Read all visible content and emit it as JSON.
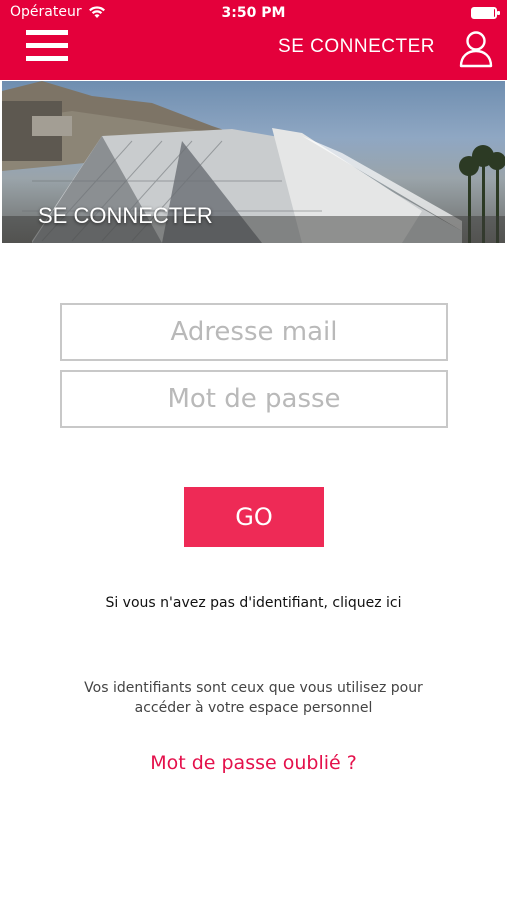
{
  "status_bar": {
    "carrier": "Opérateur",
    "time": "3:50 PM",
    "battery_level": 0.95
  },
  "header": {
    "menu_icon": "hamburger-menu-icon",
    "login_label": "SE CONNECTER",
    "user_icon": "user-icon",
    "background_color": "#e4003b"
  },
  "banner": {
    "title": "SE CONNECTER"
  },
  "form": {
    "email_placeholder": "Adresse mail",
    "password_placeholder": "Mot de passe",
    "submit_label": "GO",
    "submit_color": "#ee2a56"
  },
  "links": {
    "signup": "Si vous n'avez pas d'identifiant, cliquez ici",
    "info_line1": "Vos identifiants sont ceux que vous utilisez pour",
    "info_line2": "accéder à votre espace personnel",
    "forgot_password": "Mot de passe oublié ?"
  }
}
